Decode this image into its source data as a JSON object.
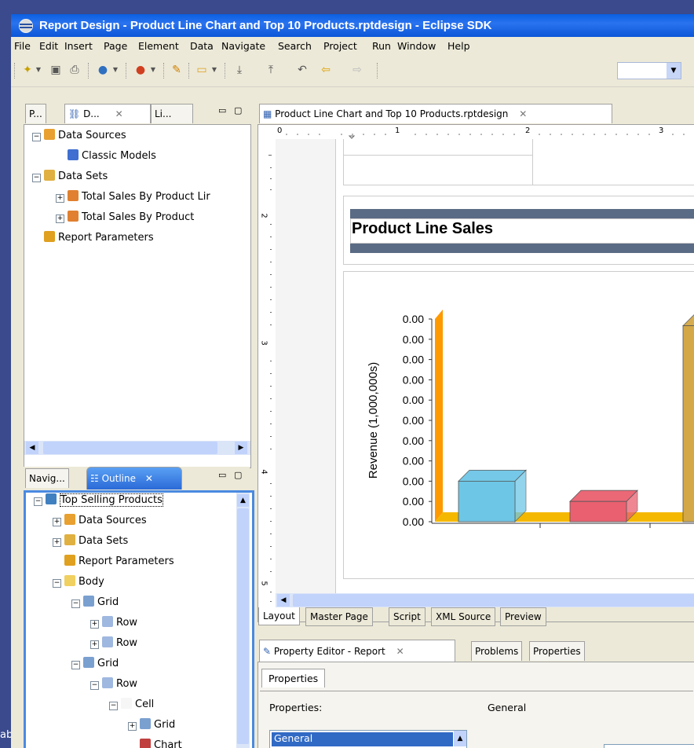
{
  "desktop": {
    "left_label": "ab"
  },
  "window": {
    "title": "Report Design - Product Line Chart and Top 10 Products.rptdesign - Eclipse SDK"
  },
  "menu": [
    "File",
    "Edit",
    "Insert",
    "Page",
    "Element",
    "Data",
    "Navigate",
    "Search",
    "Project",
    "Run",
    "Window",
    "Help"
  ],
  "data_explorer": {
    "tabs": [
      "P...",
      "D...",
      "Li..."
    ],
    "tree": [
      {
        "label": "Data Sources",
        "level": 0,
        "expander": "-",
        "icon": "data-sources-icon"
      },
      {
        "label": "Classic Models",
        "level": 1,
        "expander": "",
        "icon": "database-icon"
      },
      {
        "label": "Data Sets",
        "level": 0,
        "expander": "-",
        "icon": "data-sets-icon"
      },
      {
        "label": "Total Sales By Product Lir",
        "level": 1,
        "expander": "+",
        "icon": "dataset-icon"
      },
      {
        "label": "Total Sales By Product",
        "level": 1,
        "expander": "+",
        "icon": "dataset-icon"
      },
      {
        "label": "Report Parameters",
        "level": 0,
        "expander": "",
        "icon": "parameters-icon"
      }
    ]
  },
  "outline": {
    "tabs": [
      "Navig...",
      "Outline"
    ],
    "tree": [
      {
        "label": "Top Selling Products",
        "level": 0,
        "expander": "-"
      },
      {
        "label": "Data Sources",
        "level": 1,
        "expander": "+"
      },
      {
        "label": "Data Sets",
        "level": 1,
        "expander": "+"
      },
      {
        "label": "Report Parameters",
        "level": 1,
        "expander": ""
      },
      {
        "label": "Body",
        "level": 1,
        "expander": "-"
      },
      {
        "label": "Grid",
        "level": 2,
        "expander": "-"
      },
      {
        "label": "Row",
        "level": 3,
        "expander": "+"
      },
      {
        "label": "Row",
        "level": 3,
        "expander": "+"
      },
      {
        "label": "Grid",
        "level": 2,
        "expander": "-"
      },
      {
        "label": "Row",
        "level": 3,
        "expander": "-"
      },
      {
        "label": "Cell",
        "level": 4,
        "expander": "-"
      },
      {
        "label": "Grid",
        "level": 5,
        "expander": "+"
      },
      {
        "label": "Chart",
        "level": 5,
        "expander": ""
      }
    ]
  },
  "editor": {
    "tab_label": "Product Line Chart and Top 10 Products.rptdesign",
    "ruler_labels": [
      "0",
      "1",
      "2",
      "3"
    ],
    "vruler_labels": [
      "2",
      "3",
      "4",
      "5"
    ],
    "report_title": "Product Line Sales",
    "bottom_tabs": [
      "Layout",
      "Master Page",
      "Script",
      "XML Source",
      "Preview"
    ]
  },
  "chart_data": {
    "type": "bar",
    "ylabel": "Revenue (1,000,000s)",
    "yticks": [
      "0.00",
      "0.00",
      "0.00",
      "0.00",
      "0.00",
      "0.00",
      "0.00",
      "0.00",
      "0.00",
      "0.00",
      "0.00"
    ],
    "bars": [
      {
        "name": "cyan-bar",
        "value": 0.6,
        "color": "#6ec6e6"
      },
      {
        "name": "red-bar",
        "value": 0.3,
        "color": "#ea6070"
      },
      {
        "name": "gold-bar",
        "value": 2.9,
        "color": "#d4a846"
      }
    ],
    "floor_color": "#f5b800",
    "wall_color": "#ff9900"
  },
  "property_editor": {
    "tabs": [
      "Property Editor - Report",
      "Problems",
      "Properties"
    ],
    "sub_tab": "Properties",
    "properties_label": "Properties:",
    "section_label": "General",
    "list_selected": "General"
  }
}
